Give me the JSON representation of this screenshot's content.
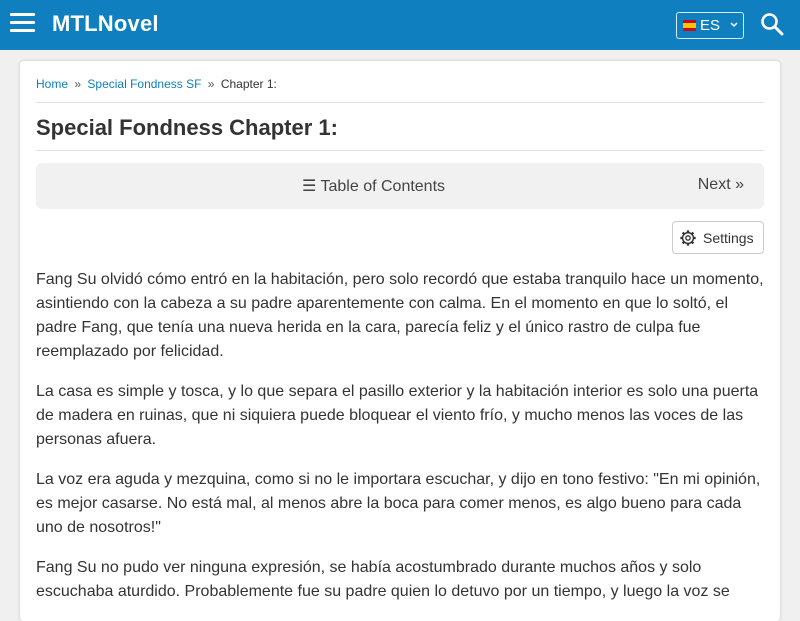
{
  "header": {
    "logo": "MTLNovel",
    "language": "ES",
    "accent_color": "#0f7fc0"
  },
  "breadcrumb": {
    "home": "Home",
    "sep1": "»",
    "novel": "Special Fondness SF",
    "sep2": "»",
    "current": "Chapter 1:"
  },
  "chapter": {
    "title": "Special Fondness Chapter 1:",
    "toc_label": "☰ Table of Contents",
    "next_label": "Next »",
    "settings_label": "Settings"
  },
  "paragraphs": [
    "Fang Su olvidó cómo entró en la habitación, pero solo recordó que estaba tranquilo hace un momento, asintiendo con la cabeza a su padre aparentemente con calma. En el momento en que lo soltó, el padre Fang, que tenía una nueva herida en la cara, parecía feliz y el único rastro de culpa fue reemplazado por felicidad.",
    "La casa es simple y tosca, y lo que separa el pasillo exterior y la habitación interior es solo una puerta de madera en ruinas, que ni siquiera puede bloquear el viento frío, y mucho menos las voces de las personas afuera.",
    "La voz era aguda y mezquina, como si no le importara escuchar, y dijo en tono festivo: \"En mi opinión, es mejor casarse. No está mal, al menos abre la boca para comer menos, es algo bueno para cada uno de nosotros!\"",
    "Fang Su no pudo ver ninguna expresión, se había acostumbrado durante muchos años y solo escuchaba aturdido. Probablemente fue su padre quien lo detuvo por un tiempo, y luego la voz se"
  ]
}
